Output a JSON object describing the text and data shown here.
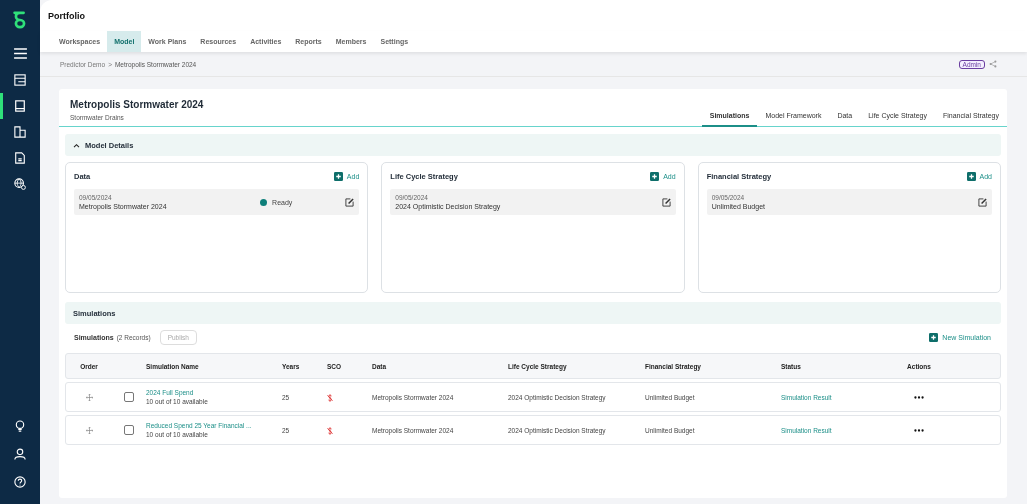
{
  "header": {
    "title": "Portfolio"
  },
  "nav": [
    {
      "label": "Workspaces",
      "selected": false
    },
    {
      "label": "Model",
      "selected": true
    },
    {
      "label": "Work Plans",
      "selected": false
    },
    {
      "label": "Resources",
      "selected": false
    },
    {
      "label": "Activities",
      "selected": false
    },
    {
      "label": "Reports",
      "selected": false
    },
    {
      "label": "Members",
      "selected": false
    },
    {
      "label": "Settings",
      "selected": false
    }
  ],
  "sidebar": {
    "items": [
      {
        "selected": false
      },
      {
        "selected": true
      },
      {
        "selected": false
      },
      {
        "selected": false
      },
      {
        "selected": false
      }
    ]
  },
  "breadcrumb": [
    "Predictor Demo",
    "Metropolis Stormwater 2024"
  ],
  "breadcrumb_separator": ">",
  "role_badge": "Admin",
  "model": {
    "title": "Metropolis Stormwater 2024",
    "subtitle": "Stormwater Drains"
  },
  "tabs": [
    {
      "label": "Simulations",
      "selected": true
    },
    {
      "label": "Model Framework",
      "selected": false
    },
    {
      "label": "Data",
      "selected": false
    },
    {
      "label": "Life Cycle Strategy",
      "selected": false
    },
    {
      "label": "Financial Strategy",
      "selected": false
    }
  ],
  "model_details": {
    "title": "Model Details",
    "expanded": true,
    "cards": [
      {
        "title": "Data",
        "add": "Add",
        "items": [
          {
            "date": "09/05/2024",
            "name": "Metropolis Stormwater 2024",
            "status": "Ready",
            "color": "#0e7f7a"
          }
        ]
      },
      {
        "title": "Life Cycle Strategy",
        "add": "Add",
        "items": [
          {
            "date": "09/05/2024",
            "name": "2024 Optimistic Decision Strategy"
          }
        ]
      },
      {
        "title": "Financial Strategy",
        "add": "Add",
        "items": [
          {
            "date": "09/05/2024",
            "name": "Unlimited Budget"
          }
        ]
      }
    ]
  },
  "simulations": {
    "section_title": "Simulations",
    "label": "Simulations",
    "count": "(2 Records)",
    "publish": "Publish",
    "new": "New Simulation",
    "columns": [
      "Order",
      "Simulation Name",
      "Years",
      "SCO",
      "Data",
      "Life Cycle Strategy",
      "Financial Strategy",
      "Status",
      "Actions"
    ],
    "rows": [
      {
        "checked": false,
        "name": "2024 Full Spend",
        "availability": "10 out of 10 available",
        "years": "25",
        "data": "Metropolis Stormwater 2024",
        "life_cycle": "2024 Optimistic Decision Strategy",
        "financial": "Unlimited Budget",
        "status": "Simulation Result"
      },
      {
        "checked": false,
        "name": "Reduced Spend 25 Year Financial ...",
        "availability": "10 out of 10 available",
        "years": "25",
        "data": "Metropolis Stormwater 2024",
        "life_cycle": "2024 Optimistic Decision Strategy",
        "financial": "Unlimited Budget",
        "status": "Simulation Result"
      }
    ]
  }
}
